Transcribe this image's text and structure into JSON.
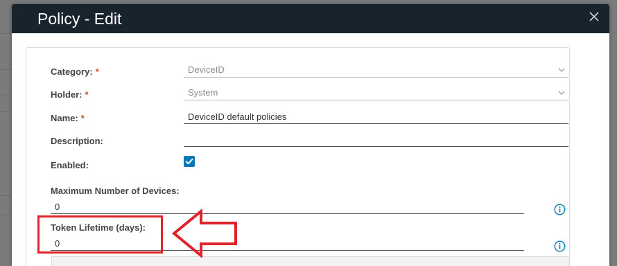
{
  "modal": {
    "title": "Policy - Edit",
    "close_icon": "close-icon"
  },
  "form": {
    "category": {
      "label": "Category:",
      "required_mark": "*",
      "value": "DeviceID",
      "icon": "chevron-down-icon"
    },
    "holder": {
      "label": "Holder:",
      "required_mark": "*",
      "value": "System",
      "icon": "chevron-down-icon"
    },
    "name": {
      "label": "Name:",
      "required_mark": "*",
      "value": "DeviceID default policies"
    },
    "description": {
      "label": "Description:",
      "value": ""
    },
    "enabled": {
      "label": "Enabled:",
      "checked": true,
      "icon": "checkmark-icon"
    },
    "max_devices": {
      "label": "Maximum Number of Devices:",
      "value": "0",
      "icon": "info-icon"
    },
    "token_lifetime": {
      "label": "Token Lifetime (days):",
      "value": "0",
      "icon": "info-icon"
    }
  },
  "annotation": {
    "highlight_color": "#e0222b",
    "arrow_icon": "left-arrow-annotation"
  },
  "colors": {
    "header_bg": "#17242d",
    "accent": "#0079b8",
    "required": "#d8483a"
  }
}
